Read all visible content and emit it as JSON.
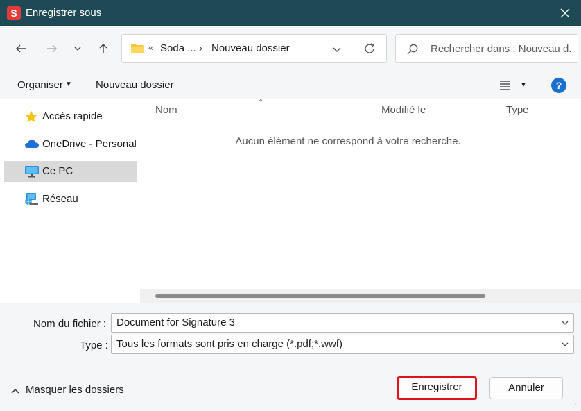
{
  "window": {
    "app_icon_letter": "S",
    "title": "Enregistrer sous"
  },
  "nav": {
    "address": {
      "overflow_chevron": "«",
      "segments": [
        "Soda ...",
        "Nouveau dossier"
      ],
      "separator": "›"
    },
    "search": {
      "placeholder": "Rechercher dans : Nouveau d..."
    }
  },
  "toolbar": {
    "organize_label": "Organiser",
    "new_folder_label": "Nouveau dossier",
    "help_label": "?"
  },
  "sidebar": {
    "items": [
      {
        "label": "Accès rapide",
        "icon": "star-icon"
      },
      {
        "label": "OneDrive - Personal",
        "icon": "cloud-icon"
      },
      {
        "label": "Ce PC",
        "icon": "computer-icon",
        "selected": true
      },
      {
        "label": "Réseau",
        "icon": "network-icon"
      }
    ]
  },
  "content": {
    "columns": [
      "Nom",
      "Modifié le",
      "Type"
    ],
    "empty_message": "Aucun élément ne correspond à votre recherche."
  },
  "form": {
    "filename_label": "Nom du fichier :",
    "filename_value": "Document for Signature 3",
    "type_label": "Type :",
    "type_value": "Tous les formats sont pris en charge (*.pdf;*.wwf)"
  },
  "footer": {
    "toggle_folders_label": "Masquer les dossiers",
    "save_label": "Enregistrer",
    "cancel_label": "Annuler"
  },
  "colors": {
    "titlebar": "#1e4a55",
    "app_icon": "#e33a3a",
    "save_highlight": "#e0131d",
    "help": "#1a6fd0"
  }
}
